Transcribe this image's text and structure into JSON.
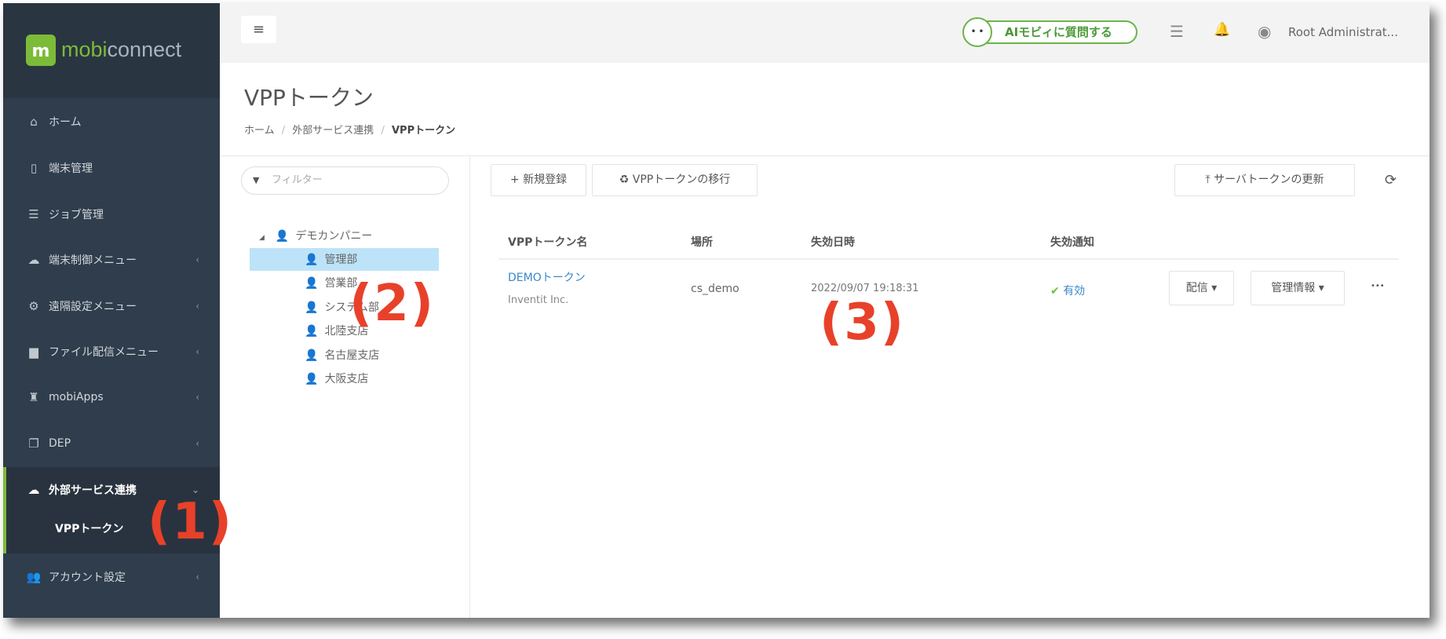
{
  "app": {
    "logo_text_1": "mobi",
    "logo_text_2": "connect",
    "logo_mark": "m"
  },
  "sidebar": {
    "items": [
      {
        "label": "ホーム",
        "icon": "home-icon",
        "glyph": "⌂"
      },
      {
        "label": "端末管理",
        "icon": "mobile-icon",
        "glyph": "▯"
      },
      {
        "label": "ジョブ管理",
        "icon": "server-icon",
        "glyph": "☰"
      },
      {
        "label": "端末制御メニュー",
        "icon": "cloud-icon",
        "glyph": "☁"
      },
      {
        "label": "遠隔設定メニュー",
        "icon": "gears-icon",
        "glyph": "⚙"
      },
      {
        "label": "ファイル配信メニュー",
        "icon": "file-icon",
        "glyph": "▆"
      },
      {
        "label": "mobiApps",
        "icon": "apps-icon",
        "glyph": "♜"
      },
      {
        "label": "DEP",
        "icon": "copy-icon",
        "glyph": "❐"
      },
      {
        "label": "外部サービス連携",
        "icon": "cloud-icon",
        "glyph": "☁"
      },
      {
        "label": "VPPトークン"
      },
      {
        "label": "アカウント設定",
        "icon": "users-icon",
        "glyph": "👥"
      }
    ],
    "chev": "‹",
    "chev_open": "⌄"
  },
  "topbar": {
    "menu_glyph": "≡",
    "ai_label": "AIモビィに質問する",
    "ai_face": "• •",
    "user": "Root Administrat...",
    "server_glyph": "☰",
    "bell_glyph": "🔔",
    "user_glyph": "◉"
  },
  "page": {
    "title": "VPPトークン",
    "breadcrumb": [
      "ホーム",
      "外部サービス連携",
      "VPPトークン"
    ],
    "sep": "/"
  },
  "filter": {
    "placeholder": "フィルター",
    "glyph": "▼"
  },
  "tree": {
    "root": "デモカンパニー",
    "toggle": "◢",
    "person": "👤",
    "children": [
      "管理部",
      "営業部",
      "システム部",
      "北陸支店",
      "名古屋支店",
      "大阪支店"
    ]
  },
  "toolbar": {
    "new": "+ 新規登録",
    "migrate": "♻ VPPトークンの移行",
    "update": "⤒ サーバトークンの更新",
    "refresh": "⟳"
  },
  "table": {
    "headers": [
      "VPPトークン名",
      "場所",
      "失効日時",
      "失効通知"
    ],
    "rows": [
      {
        "name": "DEMOトークン",
        "org": "Inventit Inc.",
        "location": "cs_demo",
        "expires": "2022/09/07 19:18:31",
        "check": "✔",
        "notice": "有効",
        "deliver": "配信 ▾",
        "manage": "管理情報 ▾",
        "more": "•••"
      }
    ]
  },
  "annotations": [
    "(1)",
    "(2)",
    "(3)"
  ],
  "colors": {
    "accent": "#7cbb38",
    "link": "#3a87c8",
    "annotation": "#e8412a"
  }
}
